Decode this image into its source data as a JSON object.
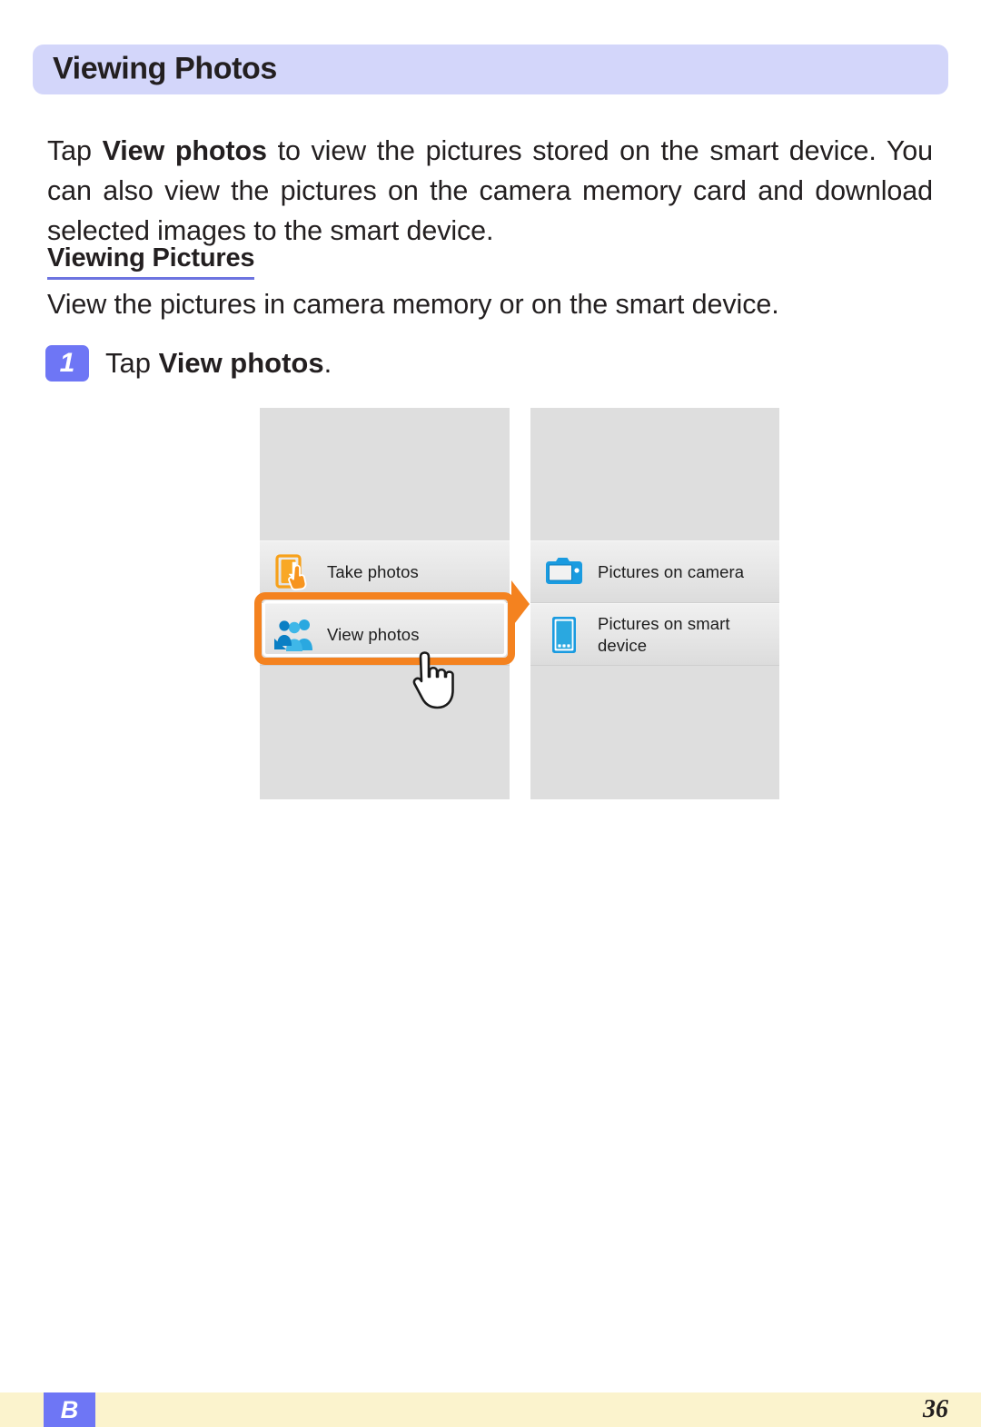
{
  "page": {
    "title": "Viewing Photos",
    "intro_lead": "Tap ",
    "intro_bold": "View photos",
    "intro_rest": " to view the pictures stored on the smart device. You can also view the pictures on the camera memory card and download selected images to the smart device."
  },
  "section": {
    "heading": "Viewing Pictures",
    "description": "View the pictures in camera memory or on the smart device."
  },
  "step": {
    "number": "1",
    "text_lead": "Tap ",
    "text_bold": "View photos",
    "text_tail": "."
  },
  "mockup_left": {
    "rows": [
      {
        "label": "Take photos",
        "icon": "tap-device-hand-icon"
      },
      {
        "label_line1": "View photos",
        "icon": "people-group-icon",
        "highlighted": true
      }
    ]
  },
  "mockup_right": {
    "rows": [
      {
        "label": "Pictures on camera",
        "icon": "camera-icon"
      },
      {
        "label_line1": "Pictures on smart",
        "label_line2": "device",
        "icon": "smart-device-icon"
      }
    ]
  },
  "footer": {
    "tab_label": "B",
    "page_number": "36"
  },
  "colors": {
    "title_bar": "#d3d6fa",
    "accent_blue": "#6e76f5",
    "heading_underline": "#6d74e0",
    "highlight_orange": "#f4821f",
    "icon_blue": "#1a9be0",
    "icon_orange": "#f7a11a",
    "footer_band": "#fbf3cd",
    "panel_gray": "#dedede"
  }
}
